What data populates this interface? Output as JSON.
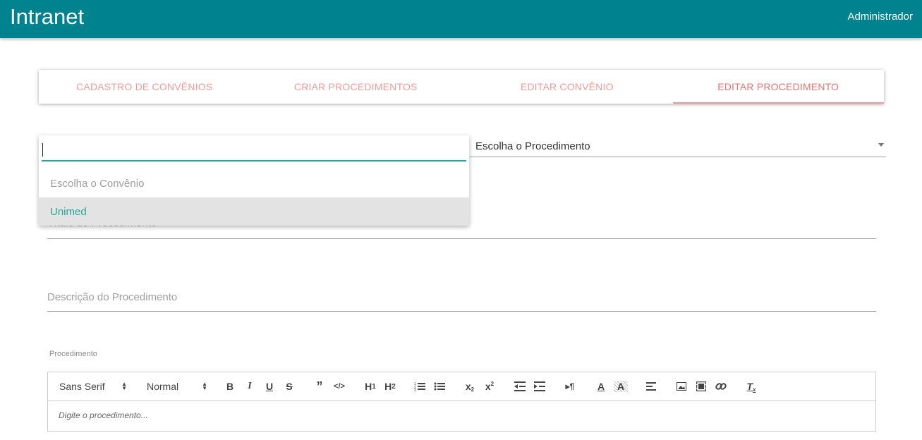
{
  "header": {
    "title": "Intranet",
    "user": "Administrador"
  },
  "tabs": [
    {
      "label": "CADASTRO DE CONVÊNIOS"
    },
    {
      "label": "CRIAR PROCEDIMENTOS"
    },
    {
      "label": "EDITAR CONVÊNIO"
    },
    {
      "label": "EDITAR PROCEDIMENTO"
    }
  ],
  "convenio_select": {
    "search_value": "",
    "options": [
      "Escolha o Convênio",
      "Unimed"
    ]
  },
  "procedimento_select": {
    "value": "Escolha o Procedimento"
  },
  "form": {
    "titulo_label": "Título do Procedimento",
    "descricao_label": "Descrição do Procedimento"
  },
  "editor": {
    "label": "Procedimento",
    "font": "Sans Serif",
    "size": "Normal",
    "placeholder": "Digite o procedimento..."
  },
  "colors": {
    "appbar": "#00838f",
    "tab_text": "#ef9a9a",
    "accent": "#26a69a"
  }
}
